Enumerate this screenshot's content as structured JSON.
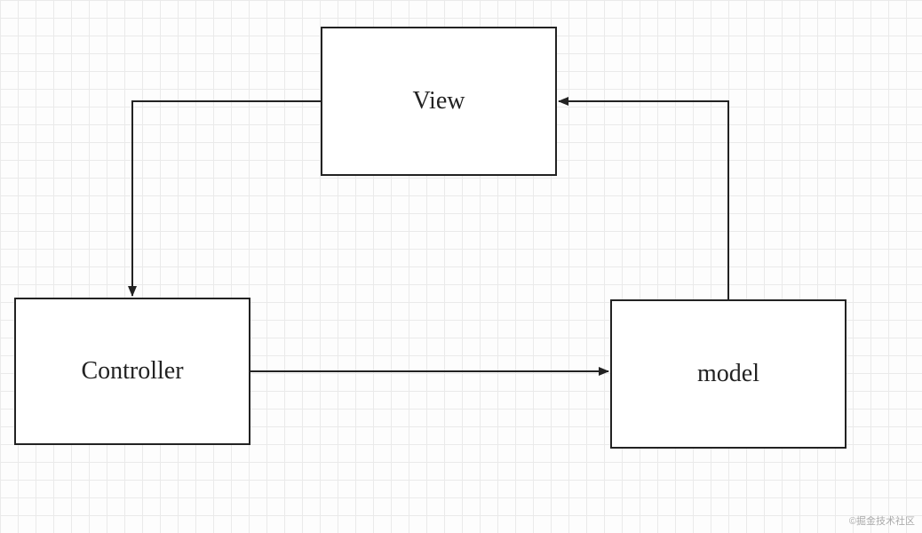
{
  "diagram": {
    "nodes": {
      "view": {
        "label": "View"
      },
      "controller": {
        "label": "Controller"
      },
      "model": {
        "label": "model"
      }
    },
    "edges": [
      {
        "from": "view",
        "to": "controller"
      },
      {
        "from": "controller",
        "to": "model"
      },
      {
        "from": "model",
        "to": "view"
      }
    ]
  },
  "watermark": "©掘金技术社区"
}
